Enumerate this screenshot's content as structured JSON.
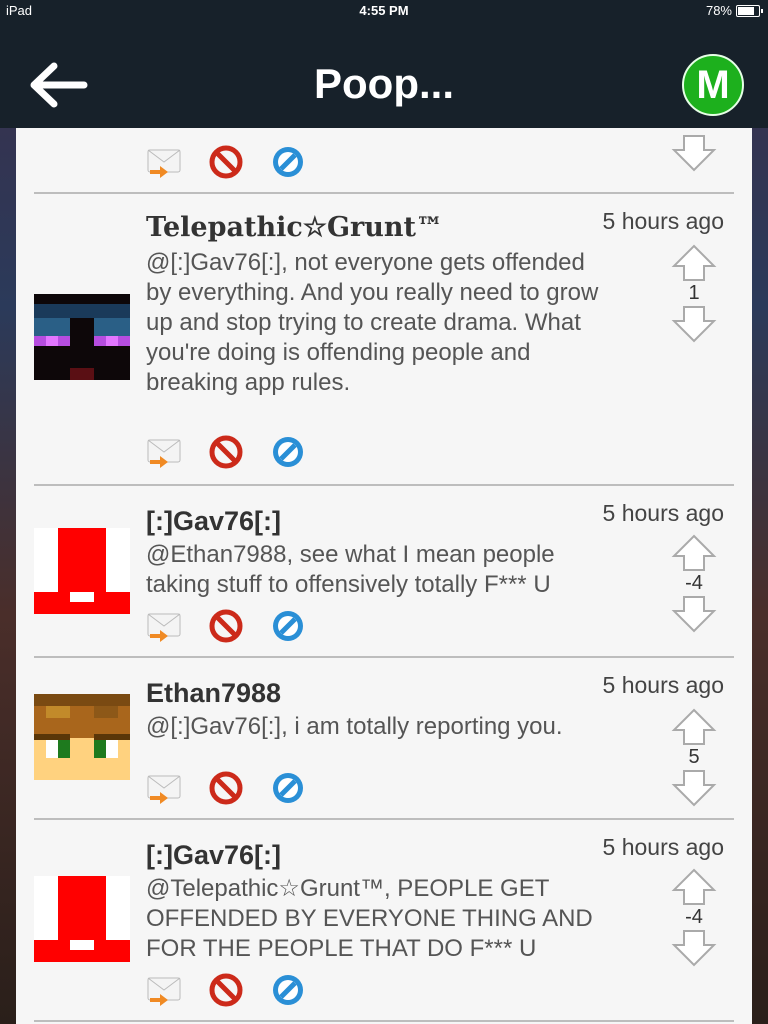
{
  "status_bar": {
    "device": "iPad",
    "time": "4:55 PM",
    "battery": "78%",
    "battery_level": 0.78
  },
  "nav": {
    "title": "Poop...",
    "badge": "M"
  },
  "posts": [
    {
      "author": "Telepathic☆Grunt™",
      "time": "5 hours ago",
      "body": "@[:]Gav76[:], not everyone gets offended by everything. And you really need to grow up and stop trying to create drama. What you're doing is offending people and breaking app rules.",
      "votes": "1"
    },
    {
      "author": "[:]Gav76[:]",
      "time": "5 hours ago",
      "body": "@Ethan7988, see what I mean people taking stuff to offensively totally F*** U",
      "votes": "-4"
    },
    {
      "author": "Ethan7988",
      "time": "5 hours ago",
      "body": "@[:]Gav76[:], i am totally reporting you.",
      "votes": "5"
    },
    {
      "author": "[:]Gav76[:]",
      "time": "5 hours ago",
      "body": "@Telepathic☆Grunt™, PEOPLE GET OFFENDED BY EVERYONE THING AND FOR THE PEOPLE THAT DO F*** U",
      "votes": "-4"
    }
  ],
  "icons": {
    "reply": "reply-envelope-icon",
    "block": "block-icon",
    "report": "report-icon",
    "up": "upvote-arrow-icon",
    "down": "downvote-arrow-icon",
    "back": "back-arrow-icon"
  },
  "colors": {
    "nav_bg": "#17212a",
    "badge": "#1db01d",
    "block_red": "#cc2a1a",
    "report_blue": "#2a8fd6"
  }
}
